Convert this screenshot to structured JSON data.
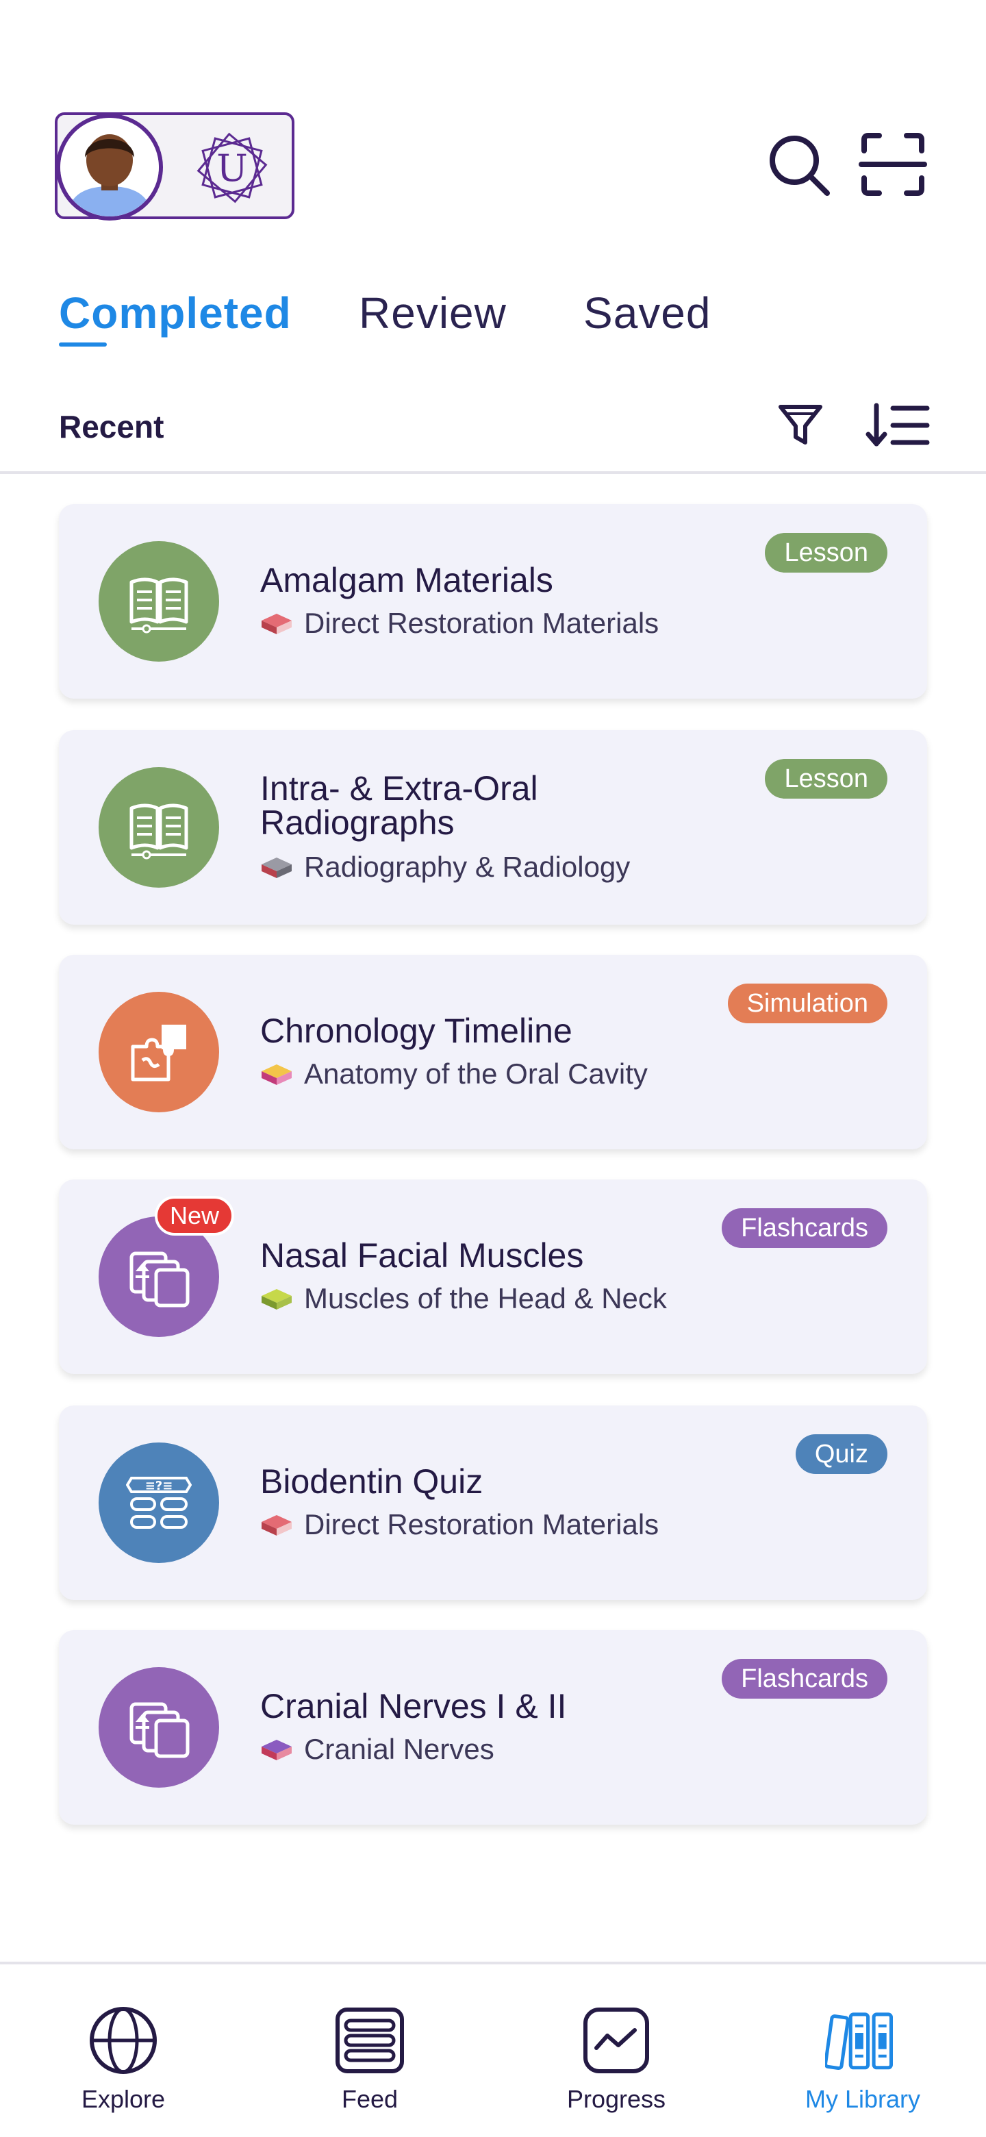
{
  "header": {
    "profile_initial": "U"
  },
  "tabs": [
    {
      "label": "Completed",
      "active": true
    },
    {
      "label": "Review",
      "active": false
    },
    {
      "label": "Saved",
      "active": false
    }
  ],
  "section": {
    "title": "Recent"
  },
  "colors": {
    "accent": "#1e88e5",
    "lesson": "#7fa468",
    "simulation": "#e37d55",
    "flashcards": "#9265b6",
    "quiz": "#4e83b9",
    "new": "#e53935"
  },
  "cards": [
    {
      "title": "Amalgam Materials",
      "subtitle": "Direct Restoration Materials",
      "type": "Lesson",
      "icon": "open-book-icon"
    },
    {
      "title": "Intra- & Extra-Oral Radiographs",
      "subtitle": "Radiography & Radiology",
      "type": "Lesson",
      "icon": "open-book-icon"
    },
    {
      "title": "Chronology Timeline",
      "subtitle": "Anatomy of the Oral Cavity",
      "type": "Simulation",
      "icon": "puzzle-icon"
    },
    {
      "title": "Nasal Facial Muscles",
      "subtitle": "Muscles of the Head & Neck",
      "type": "Flashcards",
      "icon": "flashcards-icon",
      "new_label": "New"
    },
    {
      "title": "Biodentin Quiz",
      "subtitle": "Direct Restoration Materials",
      "type": "Quiz",
      "icon": "quiz-icon"
    },
    {
      "title": "Cranial Nerves I & II",
      "subtitle": "Cranial Nerves",
      "type": "Flashcards",
      "icon": "flashcards-icon"
    }
  ],
  "nav": [
    {
      "label": "Explore",
      "icon": "globe-icon",
      "active": false
    },
    {
      "label": "Feed",
      "icon": "feed-icon",
      "active": false
    },
    {
      "label": "Progress",
      "icon": "progress-chart-icon",
      "active": false
    },
    {
      "label": "My Library",
      "icon": "library-icon",
      "active": true
    }
  ]
}
